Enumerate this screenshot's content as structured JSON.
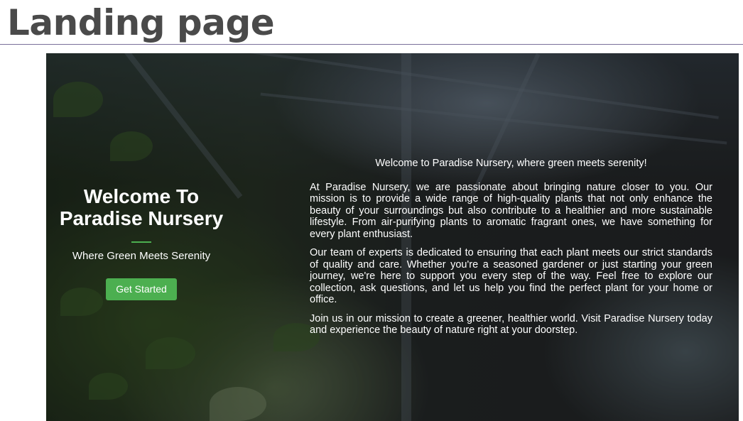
{
  "slide": {
    "title": "Landing page"
  },
  "hero": {
    "heading": "Welcome To Paradise Nursery",
    "subheading": "Where Green Meets Serenity",
    "cta_label": "Get Started"
  },
  "about": {
    "intro": "Welcome to Paradise Nursery, where green meets serenity!",
    "paragraphs": [
      "At Paradise Nursery, we are passionate about bringing nature closer to you. Our mission is to provide a wide range of high-quality plants that not only enhance the beauty of your surroundings but also contribute to a healthier and more sustainable lifestyle. From air-purifying plants to aromatic fragrant ones, we have something for every plant enthusiast.",
      "Our team of experts is dedicated to ensuring that each plant meets our strict standards of quality and care. Whether you're a seasoned gardener or just starting your green journey, we're here to support you every step of the way. Feel free to explore our collection, ask questions, and let us help you find the perfect plant for your home or office.",
      "Join us in our mission to create a greener, healthier world. Visit Paradise Nursery today and experience the beauty of nature right at your doorstep."
    ]
  },
  "colors": {
    "accent": "#4caf50",
    "title_text": "#4a4a4a",
    "rule": "#7a6f9a"
  }
}
